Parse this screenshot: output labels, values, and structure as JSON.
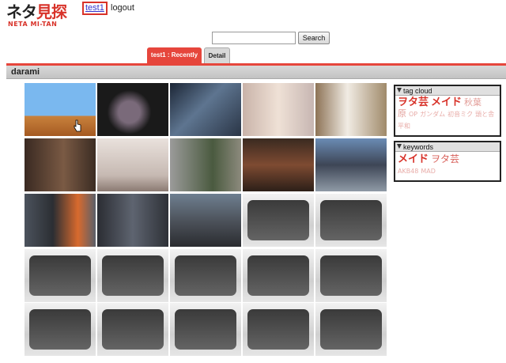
{
  "header": {
    "logo_main_a": "ネタ",
    "logo_main_b": "見探",
    "logo_sub": "NETA MI-TAN",
    "user": "test1",
    "logout": "logout"
  },
  "search": {
    "placeholder": "",
    "button": "Search"
  },
  "tabs": [
    {
      "label": "test1 : Recently",
      "active": true
    },
    {
      "label": "Detail",
      "active": false
    }
  ],
  "title": "darami",
  "grid": {
    "rows": 5,
    "cols": 5,
    "filled_count": 13
  },
  "tag_cloud": {
    "header": "tag cloud",
    "tags": [
      {
        "text": "ヲタ芸",
        "size": "xl"
      },
      {
        "text": "メイド",
        "size": "xl"
      },
      {
        "text": "秋葉",
        "size": "m"
      },
      {
        "text": "原",
        "size": "m"
      },
      {
        "text": "OP",
        "size": "s"
      },
      {
        "text": "ガンダム",
        "size": "s"
      },
      {
        "text": "初音ミク",
        "size": "s"
      },
      {
        "text": "頭と舎",
        "size": "s"
      },
      {
        "text": "平和",
        "size": "s"
      }
    ]
  },
  "keywords": {
    "header": "keywords",
    "tags": [
      {
        "text": "メイド",
        "size": "xl"
      },
      {
        "text": "ヲタ芸",
        "size": "l"
      },
      {
        "text": "AKB48",
        "size": "s"
      },
      {
        "text": "MAD",
        "size": "s"
      }
    ]
  },
  "colors": {
    "accent": "#e6463c",
    "panel_border": "#222222"
  }
}
